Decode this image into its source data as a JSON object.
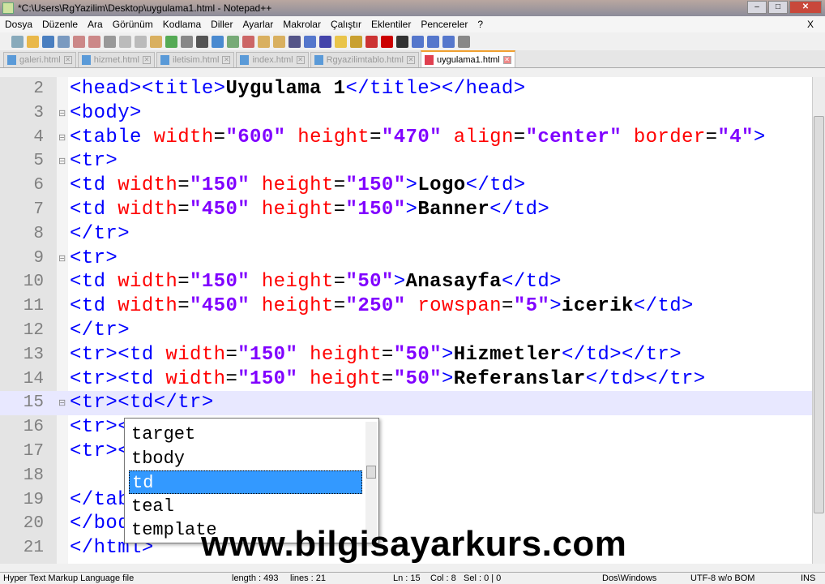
{
  "window": {
    "title": "*C:\\Users\\RgYazilim\\Desktop\\uygulama1.html - Notepad++"
  },
  "menu": [
    "Dosya",
    "Düzenle",
    "Ara",
    "Görünüm",
    "Kodlama",
    "Diller",
    "Ayarlar",
    "Makrolar",
    "Çalıştır",
    "Eklentiler",
    "Pencereler",
    "?"
  ],
  "menu_close": "X",
  "tabs": [
    {
      "label": "galeri.html"
    },
    {
      "label": "hizmet.html"
    },
    {
      "label": "iletisim.html"
    },
    {
      "label": "index.html"
    },
    {
      "label": "Rgyazilimtablo.html"
    },
    {
      "label": "uygulama1.html",
      "active": true
    }
  ],
  "lines": [
    {
      "n": "2",
      "tok": [
        [
          "t",
          "<head><title>"
        ],
        [
          "x",
          "Uygulama 1"
        ],
        [
          "t",
          "</title></head>"
        ]
      ]
    },
    {
      "n": "3",
      "fold": "⊟",
      "tok": [
        [
          "t",
          "<body>"
        ]
      ]
    },
    {
      "n": "4",
      "fold": "⊟",
      "tok": [
        [
          "t",
          "<table "
        ],
        [
          "a",
          "width"
        ],
        [
          "o",
          "="
        ],
        [
          "v",
          "\"600\""
        ],
        [
          "o",
          " "
        ],
        [
          "a",
          "height"
        ],
        [
          "o",
          "="
        ],
        [
          "v",
          "\"470\""
        ],
        [
          "o",
          " "
        ],
        [
          "a",
          "align"
        ],
        [
          "o",
          "="
        ],
        [
          "v",
          "\"center\""
        ],
        [
          "o",
          " "
        ],
        [
          "a",
          "border"
        ],
        [
          "o",
          "="
        ],
        [
          "v",
          "\"4\""
        ],
        [
          "t",
          ">"
        ]
      ]
    },
    {
      "n": "5",
      "fold": "⊟",
      "tok": [
        [
          "t",
          "<tr>"
        ]
      ]
    },
    {
      "n": "6",
      "tok": [
        [
          "t",
          "<td "
        ],
        [
          "a",
          "width"
        ],
        [
          "o",
          "="
        ],
        [
          "v",
          "\"150\""
        ],
        [
          "o",
          " "
        ],
        [
          "a",
          "height"
        ],
        [
          "o",
          "="
        ],
        [
          "v",
          "\"150\""
        ],
        [
          "t",
          ">"
        ],
        [
          "x",
          "Logo"
        ],
        [
          "t",
          "</td>"
        ]
      ]
    },
    {
      "n": "7",
      "tok": [
        [
          "t",
          "<td "
        ],
        [
          "a",
          "width"
        ],
        [
          "o",
          "="
        ],
        [
          "v",
          "\"450\""
        ],
        [
          "o",
          " "
        ],
        [
          "a",
          "height"
        ],
        [
          "o",
          "="
        ],
        [
          "v",
          "\"150\""
        ],
        [
          "t",
          ">"
        ],
        [
          "x",
          "Banner"
        ],
        [
          "t",
          "</td>"
        ]
      ]
    },
    {
      "n": "8",
      "tok": [
        [
          "t",
          "</tr>"
        ]
      ]
    },
    {
      "n": "9",
      "fold": "⊟",
      "tok": [
        [
          "t",
          "<tr>"
        ]
      ]
    },
    {
      "n": "10",
      "tok": [
        [
          "t",
          "<td "
        ],
        [
          "a",
          "width"
        ],
        [
          "o",
          "="
        ],
        [
          "v",
          "\"150\""
        ],
        [
          "o",
          " "
        ],
        [
          "a",
          "height"
        ],
        [
          "o",
          "="
        ],
        [
          "v",
          "\"50\""
        ],
        [
          "t",
          ">"
        ],
        [
          "x",
          "Anasayfa"
        ],
        [
          "t",
          "</td>"
        ]
      ]
    },
    {
      "n": "11",
      "tok": [
        [
          "t",
          "<td "
        ],
        [
          "a",
          "width"
        ],
        [
          "o",
          "="
        ],
        [
          "v",
          "\"450\""
        ],
        [
          "o",
          " "
        ],
        [
          "a",
          "height"
        ],
        [
          "o",
          "="
        ],
        [
          "v",
          "\"250\""
        ],
        [
          "o",
          " "
        ],
        [
          "a",
          "rowspan"
        ],
        [
          "o",
          "="
        ],
        [
          "v",
          "\"5\""
        ],
        [
          "t",
          ">"
        ],
        [
          "x",
          "icerik"
        ],
        [
          "t",
          "</td>"
        ]
      ]
    },
    {
      "n": "12",
      "tok": [
        [
          "t",
          "</tr>"
        ]
      ]
    },
    {
      "n": "13",
      "tok": [
        [
          "t",
          "<tr><td "
        ],
        [
          "a",
          "width"
        ],
        [
          "o",
          "="
        ],
        [
          "v",
          "\"150\""
        ],
        [
          "o",
          " "
        ],
        [
          "a",
          "height"
        ],
        [
          "o",
          "="
        ],
        [
          "v",
          "\"50\""
        ],
        [
          "t",
          ">"
        ],
        [
          "x",
          "Hizmetler"
        ],
        [
          "t",
          "</td></tr>"
        ]
      ]
    },
    {
      "n": "14",
      "tok": [
        [
          "t",
          "<tr><td "
        ],
        [
          "a",
          "width"
        ],
        [
          "o",
          "="
        ],
        [
          "v",
          "\"150\""
        ],
        [
          "o",
          " "
        ],
        [
          "a",
          "height"
        ],
        [
          "o",
          "="
        ],
        [
          "v",
          "\"50\""
        ],
        [
          "t",
          ">"
        ],
        [
          "x",
          "Referanslar"
        ],
        [
          "t",
          "</td></tr>"
        ]
      ]
    },
    {
      "n": "15",
      "fold": "⊟",
      "cur": true,
      "tok": [
        [
          "t",
          "<tr><td</tr>"
        ]
      ]
    },
    {
      "n": "16",
      "tok": [
        [
          "t",
          "<tr><"
        ]
      ]
    },
    {
      "n": "17",
      "tok": [
        [
          "t",
          "<tr><"
        ]
      ]
    },
    {
      "n": "18",
      "tok": []
    },
    {
      "n": "19",
      "tok": [
        [
          "t",
          "</tab"
        ]
      ]
    },
    {
      "n": "20",
      "tok": [
        [
          "t",
          "</bod"
        ]
      ]
    },
    {
      "n": "21",
      "tok": [
        [
          "t",
          "</html>"
        ]
      ]
    }
  ],
  "autocomplete": {
    "items": [
      "target",
      "tbody",
      "td",
      "teal",
      "template"
    ],
    "selected": 2
  },
  "watermark": "www.bilgisayarkurs.com",
  "status": {
    "filetype": "Hyper Text Markup Language file",
    "length": "length : 493",
    "lines": "lines : 21",
    "ln": "Ln : 15",
    "col": "Col : 8",
    "sel": "Sel : 0 | 0",
    "eol": "Dos\\Windows",
    "encoding": "UTF-8 w/o BOM",
    "mode": "INS"
  }
}
